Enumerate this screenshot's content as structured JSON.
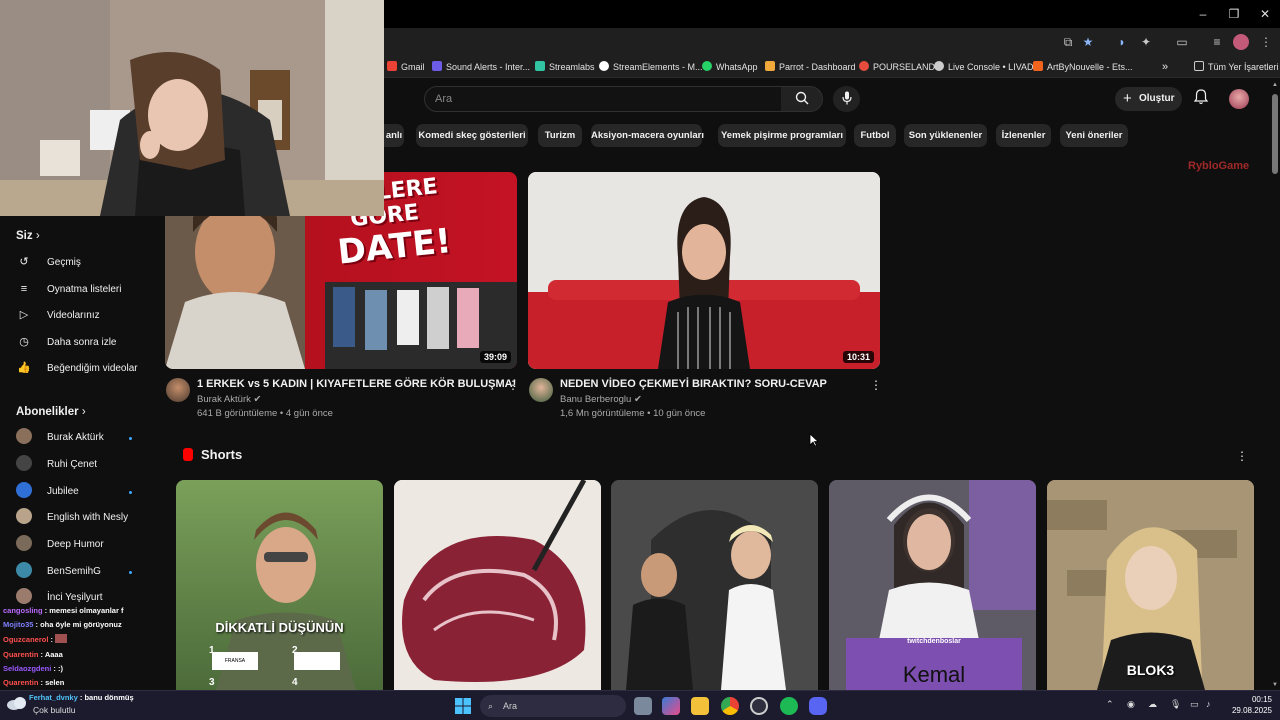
{
  "browser": {
    "window_controls": [
      "–",
      "❐",
      "✕"
    ],
    "bookmarks": [
      {
        "label": "Gmail",
        "color": "#ea4335"
      },
      {
        "label": "Sound Alerts - Inter...",
        "color": "#6c5ce7"
      },
      {
        "label": "Streamlabs",
        "color": "#31c3a2"
      },
      {
        "label": "StreamElements - M...",
        "color": "#ffffff"
      },
      {
        "label": "WhatsApp",
        "color": "#25d366"
      },
      {
        "label": "Parrot - Dashboard",
        "color": "#f2a93b"
      },
      {
        "label": "POURSELAND",
        "color": "#e74c3c"
      },
      {
        "label": "Live Console • LIVAD",
        "color": "#cccccc"
      },
      {
        "label": "ArtByNouvelle - Ets...",
        "color": "#f1641e"
      }
    ],
    "bookmarks_overflow": "»",
    "all_bookmarks": "Tüm Yer İşaretleri"
  },
  "youtube": {
    "search_placeholder": "Ara",
    "create_label": "Oluştur",
    "chips": [
      "anlı",
      "Komedi skeç gösterileri",
      "Turizm",
      "Aksiyon-macera oyunları",
      "Yemek pişirme programları",
      "Futbol",
      "Son yüklenenler",
      "İzlenenler",
      "Yeni öneriler"
    ],
    "sidebar": {
      "you_label": "Siz",
      "you_items": [
        "Geçmiş",
        "Oynatma listeleri",
        "Videolarınız",
        "Daha sonra izle",
        "Beğendiğim videolar"
      ],
      "subs_label": "Abonelikler",
      "subscriptions": [
        {
          "name": "Burak Aktürk",
          "new": true,
          "color": "#8a6f5b"
        },
        {
          "name": "Ruhi Çenet",
          "new": false,
          "color": "#444"
        },
        {
          "name": "Jubilee",
          "new": true,
          "color": "#2f6fd6"
        },
        {
          "name": "English with Nesly",
          "new": false,
          "color": "#b9a38b"
        },
        {
          "name": "Deep Humor",
          "new": false,
          "color": "#7a6a5a"
        },
        {
          "name": "BenSemihG",
          "new": true,
          "color": "#3c8aa8"
        },
        {
          "name": "İnci Yeşilyurt",
          "new": false,
          "color": "#9a7b6c"
        }
      ]
    },
    "videos": [
      {
        "title": "1 ERKEK vs 5 KADIN | KIYAFETLERE GÖRE KÖR BULUŞMA!",
        "channel": "Burak Aktürk",
        "meta": "641 B görüntüleme • 4 gün önce",
        "duration": "39:09",
        "thumb_text_1": "FETLERE",
        "thumb_text_2": "GÖRE",
        "thumb_text_3": "DATE!"
      },
      {
        "title": "NEDEN VİDEO ÇEKMEYİ BIRAKTIN?  SORU-CEVAP",
        "channel": "Banu Berberoglu",
        "meta": "1,6 Mn görüntüleme • 10 gün önce",
        "duration": "10:31"
      }
    ],
    "shorts_label": "Shorts",
    "shorts": [
      {
        "overlay": "DİKKATLİ DÜŞÜNÜN",
        "badge1": "FRANSA",
        "num1": "1",
        "num2": "2",
        "num3": "3",
        "num4": "4"
      },
      {
        "overlay": ""
      },
      {
        "overlay": ""
      },
      {
        "overlay": "Kemal",
        "sub": "twitchdenboslar"
      },
      {
        "overlay": "BLOK3"
      }
    ],
    "watermark": "RybloGame"
  },
  "chat": [
    {
      "user": "cangosling",
      "msg": "memesi olmayanlar f",
      "color": "#b96bff"
    },
    {
      "user": "Mojito35",
      "msg": "oha öyle mi görüyonuz",
      "color": "#7f7fff"
    },
    {
      "user": "Oguzcanerol",
      "msg": "",
      "color": "#ff4f4f"
    },
    {
      "user": "Quarentin",
      "msg": "Aaaa",
      "color": "#ff4f4f"
    },
    {
      "user": "Seldaozgdeni",
      "msg": ":)",
      "color": "#9b59ff"
    },
    {
      "user": "Quarentin",
      "msg": "selen",
      "color": "#ff4f4f"
    },
    {
      "user": "Ferhat_dvnky",
      "msg": "banu dönmüş",
      "color": "#4fc3f7"
    }
  ],
  "taskbar": {
    "weather": "Çok bulutlu",
    "search": "Ara",
    "time": "00:15",
    "date": "29.08.2025"
  }
}
